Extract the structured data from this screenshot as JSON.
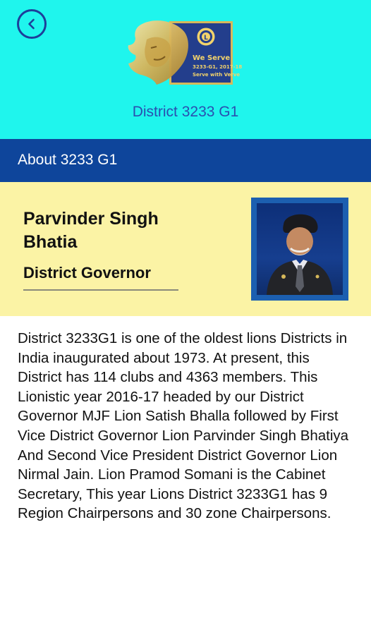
{
  "header": {
    "district_title": "District 3233 G1",
    "back_icon": "chevron-left-icon",
    "logo": {
      "badge_line1": "We Serve",
      "badge_line2": "3233-G1, 2017-18",
      "badge_line3": "Serve with Verve"
    }
  },
  "about_bar": {
    "title": "About 3233 G1"
  },
  "profile": {
    "name": "Parvinder Singh Bhatia",
    "role": "District Governor"
  },
  "description": "District 3233G1 is one of the oldest lions Districts in India inaugurated about 1973. At present, this District has 114 clubs and 4363 members. This Lionistic year 2016-17 headed by our District Governor MJF Lion Satish Bhalla followed by First Vice District Governor Lion Parvinder Singh Bhatiya And Second Vice President District Governor Lion Nirmal Jain.  Lion Pramod Somani is the Cabinet Secretary, This year Lions District 3233G1 has 9 Region Chairpersons and 30 zone Chairpersons.",
  "colors": {
    "header_bg": "#1ff5ed",
    "bar_bg": "#0e459b",
    "profile_bg": "#fbf3a5",
    "accent": "#2a4fb0"
  }
}
